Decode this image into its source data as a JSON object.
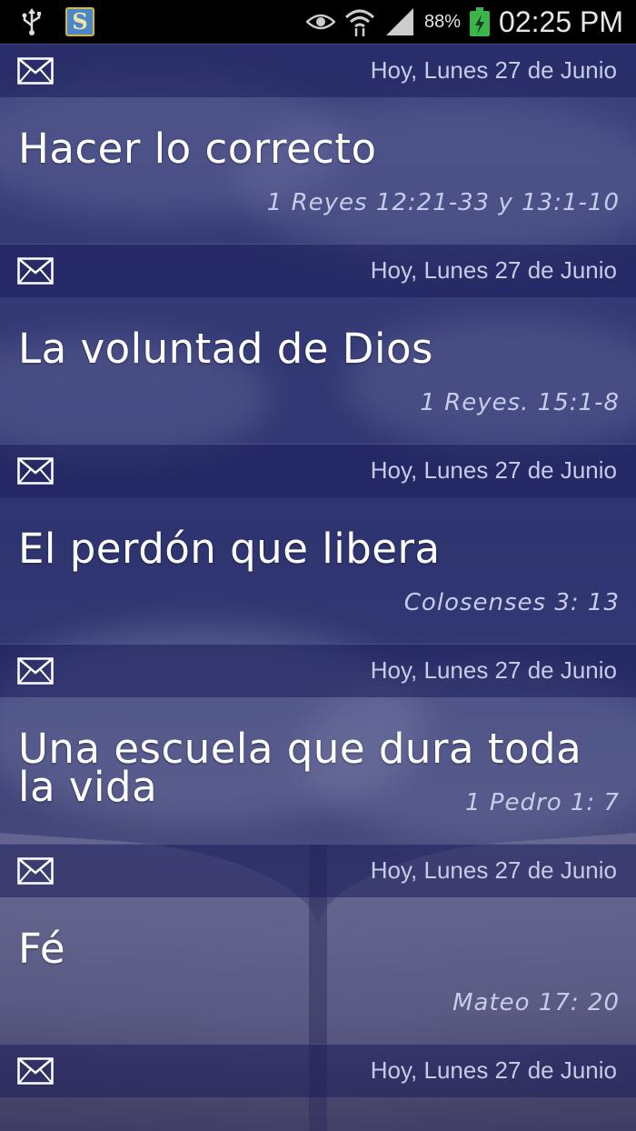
{
  "status_bar": {
    "battery_percent": "88%",
    "time": "02:25 PM"
  },
  "entries": [
    {
      "date": "Hoy, Lunes 27 de Junio",
      "title": "Hacer lo correcto",
      "reference": "1 Reyes 12:21-33 y 13:1-10"
    },
    {
      "date": "Hoy, Lunes 27 de Junio",
      "title": "La voluntad de Dios",
      "reference": "1 Reyes. 15:1-8"
    },
    {
      "date": "Hoy, Lunes 27 de Junio",
      "title": "El perdón que libera",
      "reference": "Colosenses 3: 13"
    },
    {
      "date": "Hoy, Lunes 27 de Junio",
      "title": "Una escuela que dura toda la vida",
      "reference": "1 Pedro 1: 7"
    },
    {
      "date": "Hoy, Lunes 27 de Junio",
      "title": "Fé",
      "reference": "Mateo 17: 20"
    },
    {
      "date": "Hoy, Lunes 27 de Junio",
      "title": "",
      "reference": ""
    }
  ]
}
